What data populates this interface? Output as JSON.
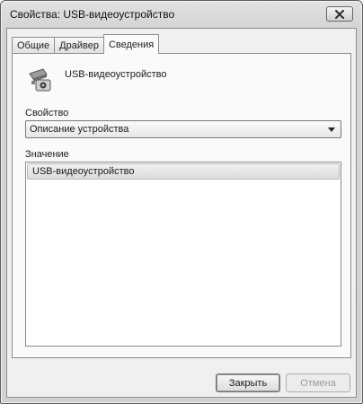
{
  "window": {
    "title": "Свойства: USB-видеоустройство"
  },
  "tabs": [
    {
      "label": "Общие",
      "active": false
    },
    {
      "label": "Драйвер",
      "active": false
    },
    {
      "label": "Сведения",
      "active": true
    }
  ],
  "device": {
    "name": "USB-видеоустройство",
    "icon": "webcam-icon"
  },
  "property": {
    "label": "Свойство",
    "selected": "Описание устройства"
  },
  "value": {
    "label": "Значение",
    "items": [
      "USB-видеоустройство"
    ]
  },
  "buttons": {
    "close_label": "Закрыть",
    "cancel_label": "Отмена"
  },
  "colors": {
    "titlebar": "#d8d8d8",
    "panel": "#fafafa",
    "selection": "#e2e2e2",
    "disabled_text": "#9a9a9a"
  }
}
